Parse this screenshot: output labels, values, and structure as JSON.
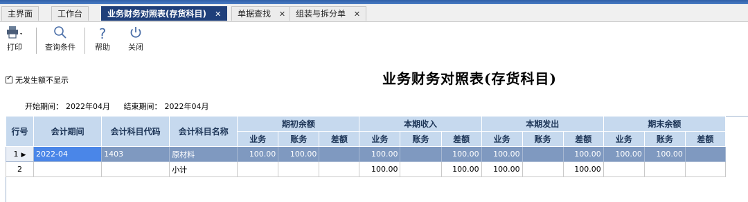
{
  "tabs": [
    {
      "label": "主界面",
      "closable": false,
      "active": false
    },
    {
      "label": "工作台",
      "closable": false,
      "active": false
    },
    {
      "label": "业务财务对照表(存货科目)",
      "closable": true,
      "active": true
    },
    {
      "label": "单据查找",
      "closable": true,
      "active": false
    },
    {
      "label": "组装与拆分单",
      "closable": true,
      "active": false
    }
  ],
  "close_glyph": "✕",
  "toolbar": {
    "print": {
      "label": "打印",
      "icon": "printer-icon"
    },
    "query": {
      "label": "查询条件",
      "icon": "search-icon"
    },
    "help": {
      "label": "帮助",
      "icon": "help-icon"
    },
    "close": {
      "label": "关闭",
      "icon": "power-icon"
    }
  },
  "options": {
    "no_occurrence_label": "无发生额不显示",
    "no_occurrence_checked": true
  },
  "report": {
    "title": "业务财务对照表(存货科目)"
  },
  "period": {
    "start_label": "开始期间：",
    "start_value": "2022年04月",
    "end_label": "结束期间：",
    "end_value": "2022年04月"
  },
  "table": {
    "headers": {
      "row_no": "行号",
      "period": "会计期间",
      "code": "会计科目代码",
      "name": "会计科目名称",
      "groups": [
        "期初余额",
        "本期收入",
        "本期发出",
        "期末余额"
      ],
      "sub": [
        "业务",
        "账务",
        "差额"
      ]
    },
    "rows": [
      {
        "no": "1",
        "period": "2022-04",
        "code": "1403",
        "name": "原材料",
        "values": [
          "100.00",
          "100.00",
          "",
          "100.00",
          "",
          "100.00",
          "100.00",
          "",
          "100.00",
          "100.00",
          "100.00",
          ""
        ]
      },
      {
        "no": "2",
        "period": "",
        "code": "",
        "name": "小计",
        "values": [
          "",
          "",
          "",
          "100.00",
          "",
          "100.00",
          "100.00",
          "",
          "100.00",
          "",
          "",
          ""
        ]
      }
    ]
  },
  "colors": {
    "accent": "#1f3f7a",
    "header_bg": "#c6d9ee",
    "selected_row": "#7f99c0",
    "selected_cell": "#4a86e8"
  }
}
